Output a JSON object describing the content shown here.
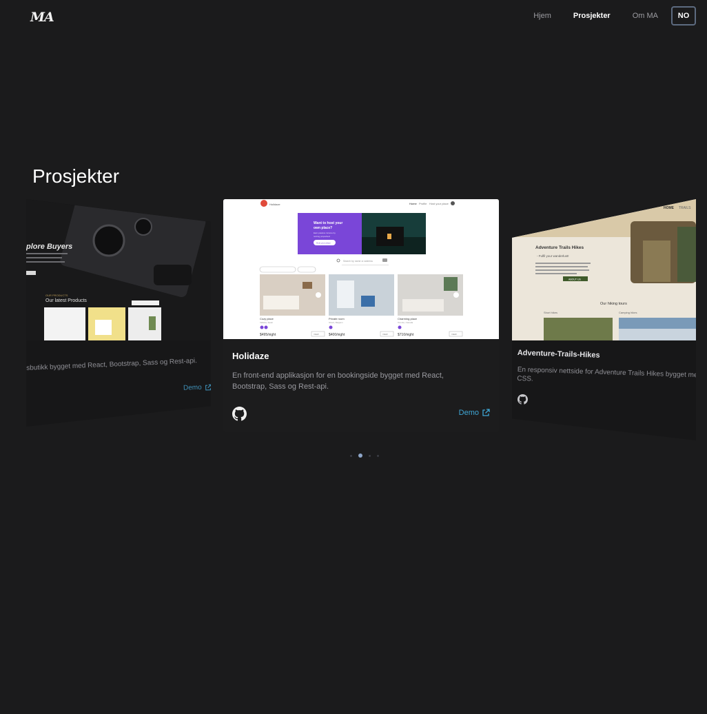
{
  "header": {
    "logo": "MA",
    "nav": [
      {
        "label": "Hjem",
        "active": false
      },
      {
        "label": "Prosjekter",
        "active": true
      },
      {
        "label": "Om MA",
        "active": false
      }
    ],
    "language": "NO"
  },
  "section": {
    "title": "Prosjekter"
  },
  "cards": {
    "left": {
      "description": "sbutikk bygget med React, Bootstrap, Sass og Rest-api.",
      "demo_label": "Demo",
      "shot": {
        "hero_text": "plore Buyers",
        "section_label": "OUR PRODUCTS",
        "section_title": "Our latest Products"
      }
    },
    "center": {
      "title": "Holidaze",
      "description": "En front-end applikasjon for en bookingside bygget med React, Bootstrap, Sass og Rest-api.",
      "demo_label": "Demo",
      "shot": {
        "brand": "Holidaze",
        "nav": [
          "Home",
          "Profile",
          "Host your place"
        ],
        "banner_title": "Want to host your own place?",
        "banner_sub": "Earn passive income by renting properties!",
        "banner_button": "Host your place",
        "search_placeholder": "Search by name or address",
        "listings": [
          {
            "name": "Cozy place",
            "location": "Valletta, Spain",
            "price": "$495/night",
            "button": "VIEW"
          },
          {
            "name": "Private room",
            "location": "Ghent, Belgium",
            "price": "$400/night",
            "button": "VIEW"
          },
          {
            "name": "Charming place",
            "location": "Toronto, Canada",
            "price": "$710/night",
            "button": "VIEW"
          }
        ]
      }
    },
    "right": {
      "title": "Adventure-Trails-Hikes",
      "description": "En responsiv nettside for Adventure Trails Hikes bygget med",
      "description2": "CSS.",
      "shot": {
        "nav": [
          "HOME",
          "TRAILS"
        ],
        "title": "Adventure Trails Hikes",
        "subtitle": "- Fulfil your wanderlust!",
        "button": "ABOUT US",
        "section": "Our hiking tours",
        "tours": [
          "Short hikes",
          "Camping hikes"
        ]
      }
    }
  },
  "carousel": {
    "total": 4,
    "active": 1
  }
}
